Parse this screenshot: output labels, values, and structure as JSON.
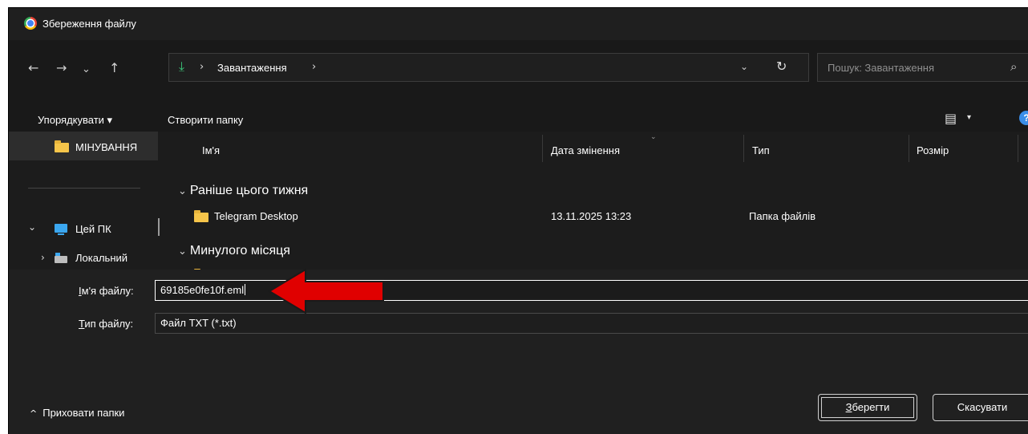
{
  "window": {
    "title": "Збереження файлу"
  },
  "nav": {
    "back": "←",
    "forward": "→",
    "recent": "⌄",
    "up": "↑",
    "address": {
      "sep1": "›",
      "location": "Завантаження",
      "sep2": "›",
      "dropdown": "⌄",
      "refresh": "↻"
    },
    "search_placeholder": "Пошук: Завантаження",
    "search_glyph": "⌕"
  },
  "commands": {
    "organize": "Упорядкувати ▾",
    "new_folder": "Створити папку",
    "view_glyph": "▤",
    "view_dropdown": "▾",
    "help": "?"
  },
  "sidebar": {
    "selected_folder": "МІНУВАННЯ",
    "this_pc": "Цей ПК",
    "local_drive": "Локальний",
    "caret_open": "⌄",
    "caret_closed": "›"
  },
  "columns": {
    "name": "Ім'я",
    "date": "Дата змінення",
    "type": "Тип",
    "size": "Розмір",
    "sort_glyph": "⌄"
  },
  "groups": [
    {
      "label": "Раніше цього тижня",
      "chevron": "⌄"
    },
    {
      "label": "Минулого місяця",
      "chevron": "⌄"
    }
  ],
  "rows": [
    {
      "name": "Telegram Desktop",
      "date": "13.11.2025 13:23",
      "type": "Папка файлів"
    }
  ],
  "form": {
    "filename_label_ul": "І",
    "filename_label_rest": "м'я файлу:",
    "filename_value": "69185e0fe10f.eml",
    "filetype_label_ul": "Т",
    "filetype_label_rest": "ип файлу:",
    "filetype_value": "Файл TXT (*.txt)"
  },
  "footer": {
    "hide_folders": "Приховати папки",
    "hide_chevron": "^",
    "save_ul": "З",
    "save_rest": "берегти",
    "cancel": "Скасувати"
  },
  "colors": {
    "background": "#1c1c1c",
    "accent_download": "#3cc77a",
    "folder": "#f6c54a",
    "annotation_arrow": "#e00000"
  }
}
